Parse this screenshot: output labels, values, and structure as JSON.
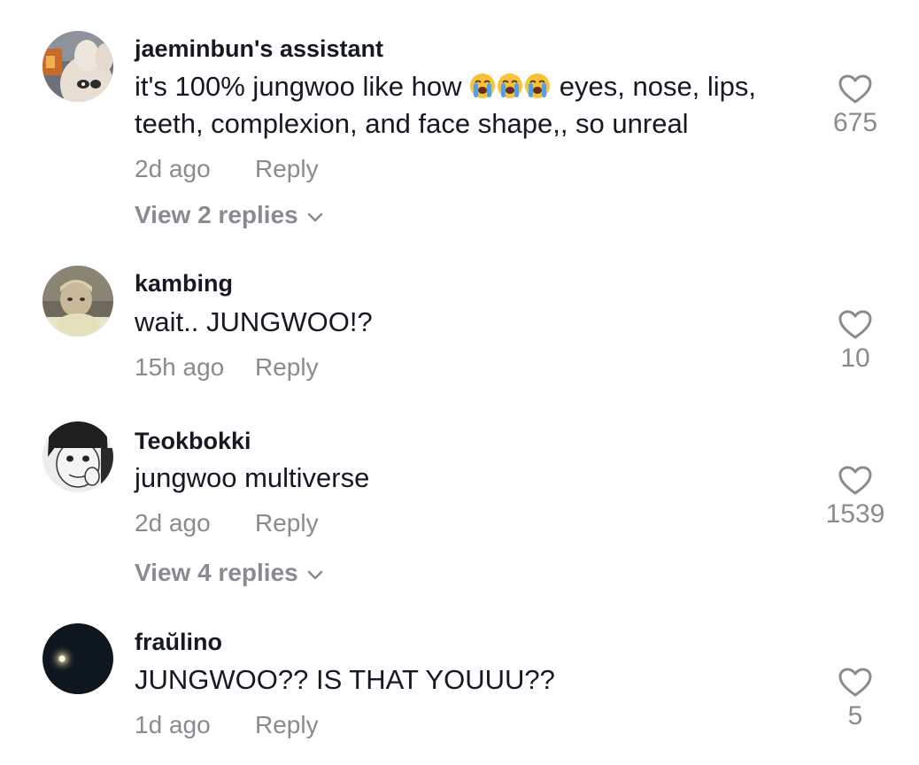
{
  "comments": [
    {
      "username": "jaeminbun's assistant",
      "text_before": "it's 100% jungwoo like how ",
      "emojis": [
        "loudly-crying-face",
        "loudly-crying-face",
        "loudly-crying-face"
      ],
      "text_after": " eyes, nose, lips, teeth, complexion, and face shape,, so unreal",
      "time": "2d ago",
      "reply_label": "Reply",
      "likes": "675",
      "view_replies": "View 2 replies"
    },
    {
      "username": "kambing",
      "text": "wait.. JUNGWOO!?",
      "time": "15h ago",
      "reply_label": "Reply",
      "likes": "10"
    },
    {
      "username": "Teokbokki",
      "text": "jungwoo multiverse",
      "time": "2d ago",
      "reply_label": "Reply",
      "likes": "1539",
      "view_replies": "View 4 replies"
    },
    {
      "username": "fraŭlino",
      "text": "JUNGWOO?? IS THAT YOUUU??",
      "time": "1d ago",
      "reply_label": "Reply",
      "likes": "5"
    }
  ],
  "icons": {
    "like": "heart-outline-icon",
    "expand": "chevron-down-icon",
    "emoji": "loudly-crying-face"
  },
  "colors": {
    "text": "#161823",
    "secondary": "#8a8b91",
    "background": "#ffffff"
  }
}
